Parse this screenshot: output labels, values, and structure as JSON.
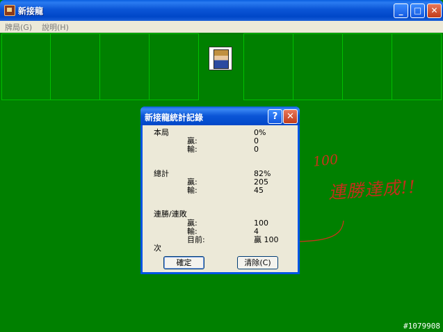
{
  "window": {
    "title": "新接龍",
    "controls": {
      "minimize": "_",
      "maximize": "□",
      "close": "✕"
    }
  },
  "menu": [
    "牌局(G)",
    "說明(H)"
  ],
  "board": {
    "king_card": "king-card-icon"
  },
  "dialog": {
    "title": "新接龍統計記錄",
    "help": "?",
    "close": "✕",
    "this_game": {
      "heading": "本局",
      "percent": "0%",
      "wins_label": "贏:",
      "wins": "0",
      "losses_label": "輸:",
      "losses": "0"
    },
    "total": {
      "heading": "總計",
      "percent": "82%",
      "wins_label": "贏:",
      "wins": "205",
      "losses_label": "輸:",
      "losses": "45"
    },
    "streaks": {
      "heading": "連勝/連敗",
      "wins_label": "贏:",
      "wins": "100",
      "losses_label": "輸:",
      "losses": "4",
      "current_label": "目前:",
      "current": "贏 100",
      "suffix": "次"
    },
    "ok_button": "確定",
    "clear_button": "清除(C)"
  },
  "annotation": {
    "number": "100",
    "text": "連勝達成!!"
  },
  "watermark": "#1079908",
  "colors": {
    "felt": "#008000",
    "title_blue": "#0054e3",
    "annotation_red": "#c8341c"
  }
}
